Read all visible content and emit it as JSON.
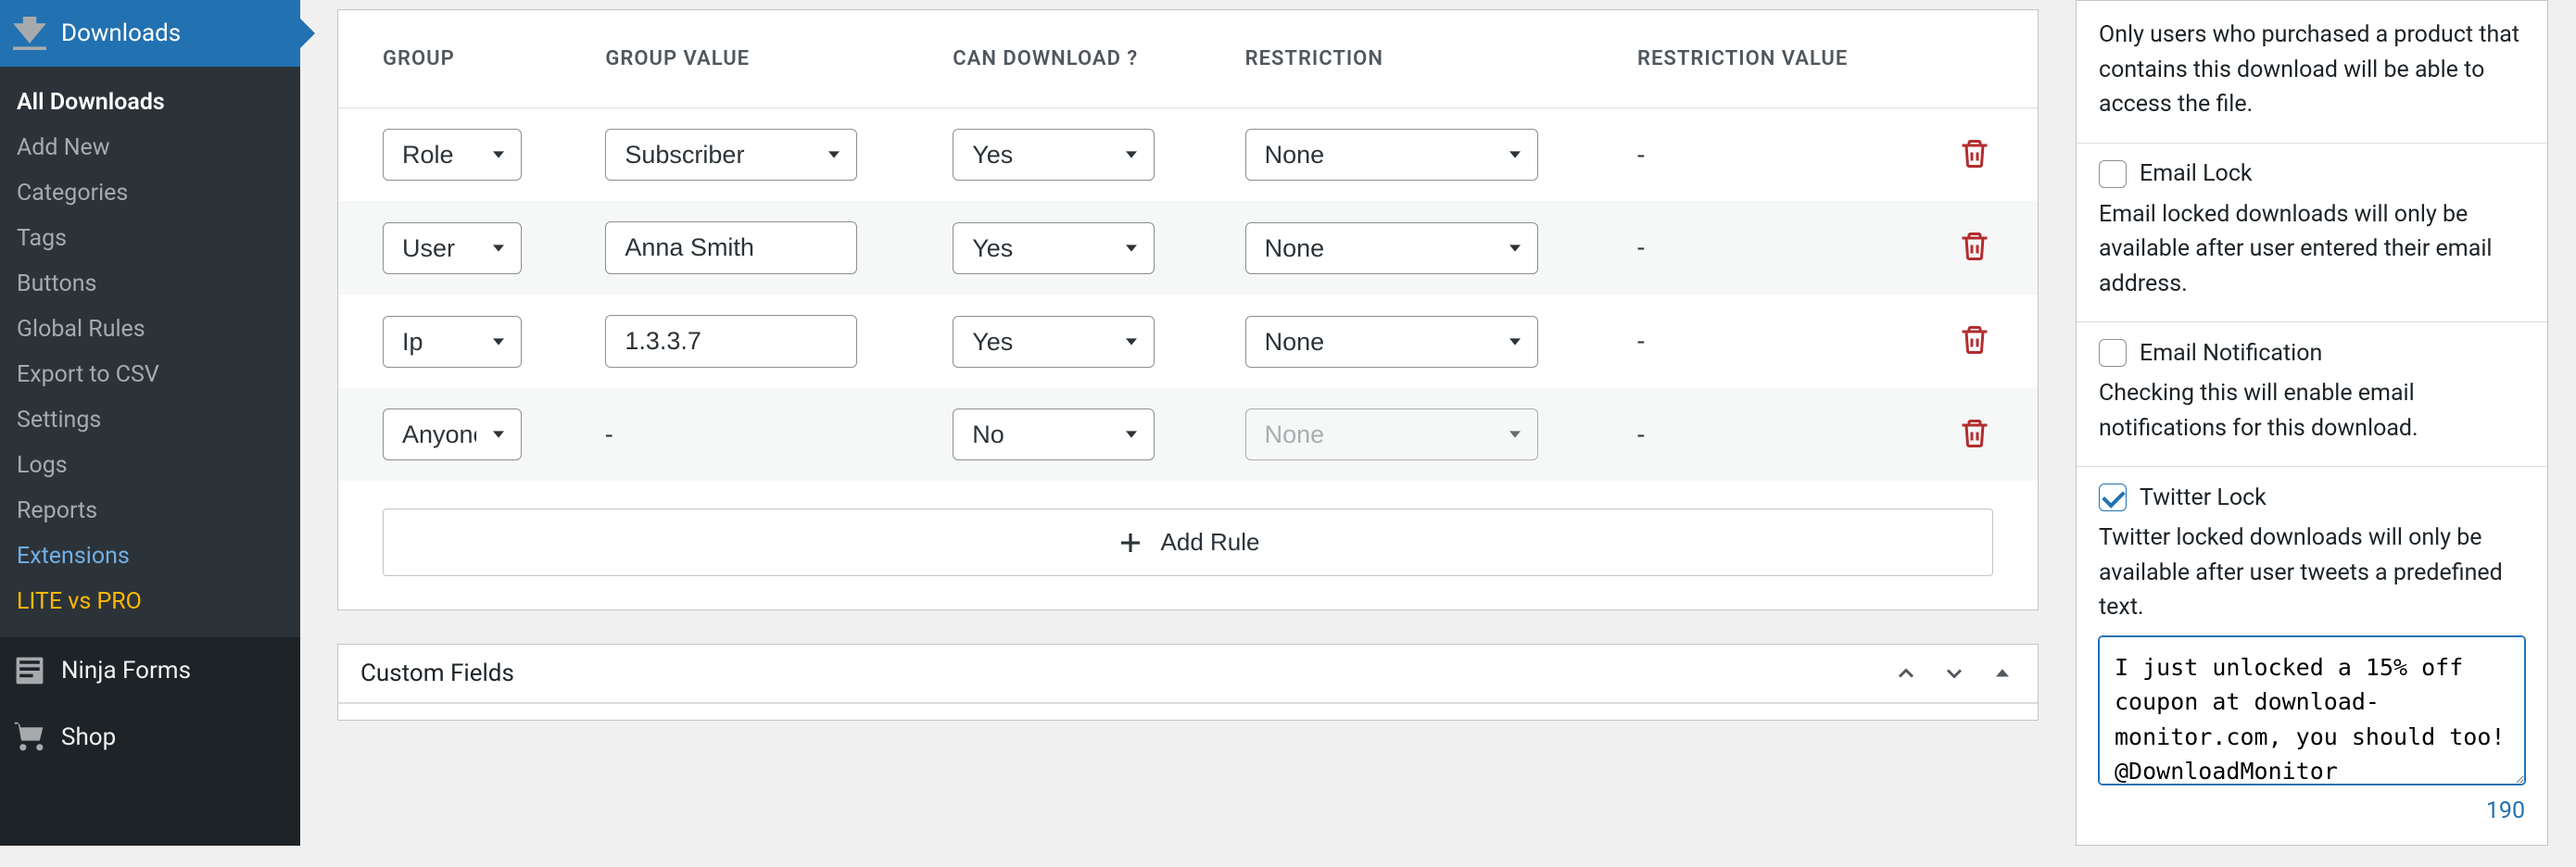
{
  "sidebar": {
    "header": "Downloads",
    "submenu": [
      {
        "label": "All Downloads",
        "cls": "current"
      },
      {
        "label": "Add New",
        "cls": ""
      },
      {
        "label": "Categories",
        "cls": ""
      },
      {
        "label": "Tags",
        "cls": ""
      },
      {
        "label": "Buttons",
        "cls": ""
      },
      {
        "label": "Global Rules",
        "cls": ""
      },
      {
        "label": "Export to CSV",
        "cls": ""
      },
      {
        "label": "Settings",
        "cls": ""
      },
      {
        "label": "Logs",
        "cls": ""
      },
      {
        "label": "Reports",
        "cls": ""
      },
      {
        "label": "Extensions",
        "cls": "blue"
      },
      {
        "label": "LITE vs PRO",
        "cls": "highlight"
      }
    ],
    "ninja": "Ninja Forms",
    "shop": "Shop"
  },
  "table": {
    "headers": {
      "group": "GROUP",
      "group_value": "GROUP VALUE",
      "can_download": "CAN DOWNLOAD ?",
      "restriction": "RESTRICTION",
      "restriction_value": "RESTRICTION VALUE"
    },
    "rows": [
      {
        "group": "Role",
        "gv_type": "select",
        "gv": "Subscriber",
        "cd": "Yes",
        "r": "None",
        "r_disabled": false,
        "rv": "-"
      },
      {
        "group": "User",
        "gv_type": "text",
        "gv": "Anna Smith",
        "cd": "Yes",
        "r": "None",
        "r_disabled": false,
        "rv": "-"
      },
      {
        "group": "Ip",
        "gv_type": "text",
        "gv": "1.3.3.7",
        "cd": "Yes",
        "r": "None",
        "r_disabled": false,
        "rv": "-"
      },
      {
        "group": "Anyone",
        "gv_type": "dash",
        "gv": "-",
        "cd": "No",
        "r": "None",
        "r_disabled": true,
        "rv": "-"
      }
    ],
    "add_rule": "Add Rule"
  },
  "custom_fields_title": "Custom Fields",
  "right": {
    "purchase_desc": "Only users who purchased a product that contains this download will be able to access the file.",
    "email_lock": {
      "label": "Email Lock",
      "checked": false,
      "desc": "Email locked downloads will only be available after user entered their email address."
    },
    "email_notif": {
      "label": "Email Notification",
      "checked": false,
      "desc": "Checking this will enable email notifications for this download."
    },
    "twitter": {
      "label": "Twitter Lock",
      "checked": true,
      "desc": "Twitter locked downloads will only be available after user tweets a predefined text.",
      "text": "I just unlocked a 15% off coupon at download-monitor.com, you should too! @DownloadMonitor",
      "counter": "190"
    }
  }
}
